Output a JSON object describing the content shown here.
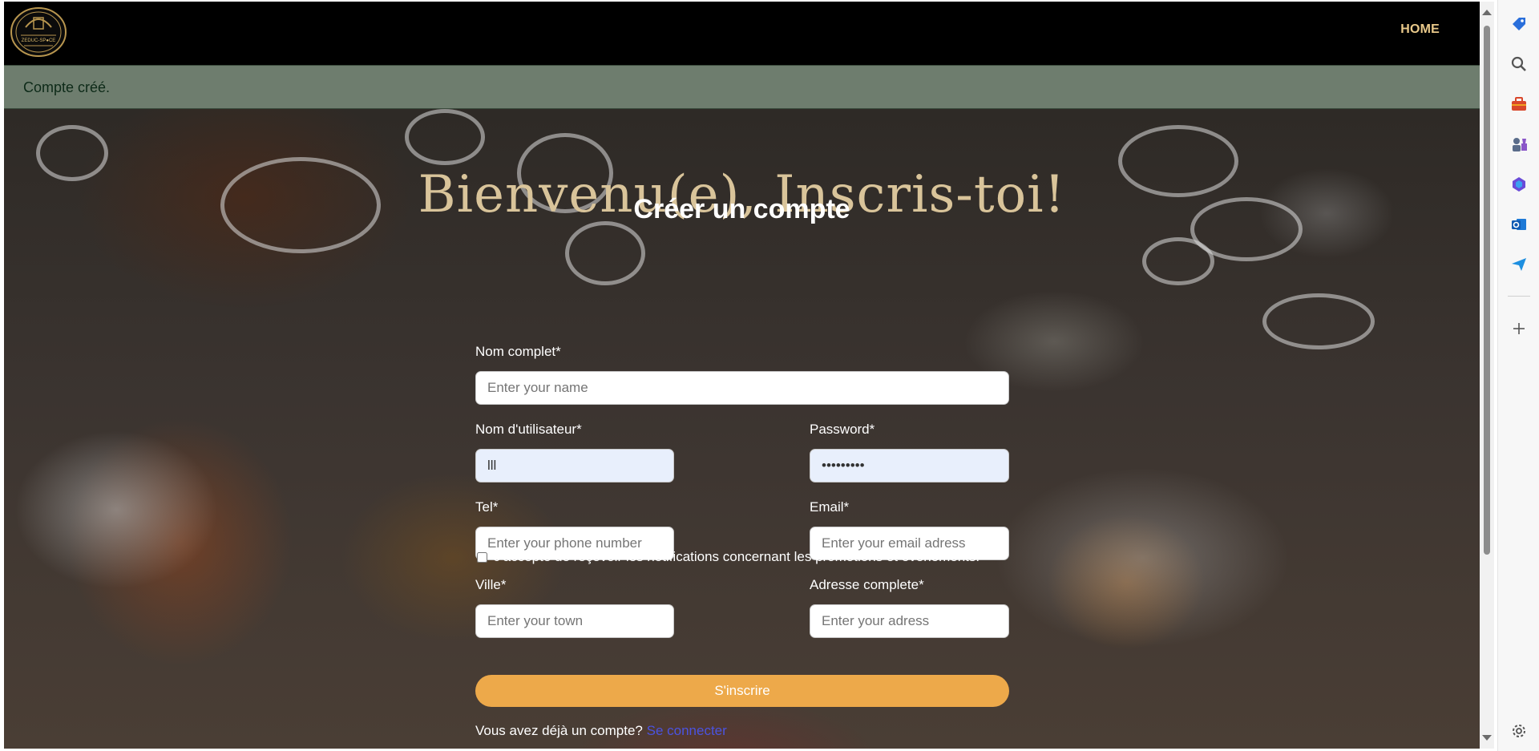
{
  "navbar": {
    "home_label": "HOME",
    "logo_text": "ZEDUC-SPACE"
  },
  "alert": {
    "message": "Compte créé."
  },
  "hero": {
    "title": "Bienvenu(e), Inscris-toi!"
  },
  "form": {
    "title": "Créer un compte",
    "fullname": {
      "label": "Nom complet*",
      "placeholder": "Enter your name",
      "value": ""
    },
    "username": {
      "label": "Nom d'utilisateur*",
      "placeholder": "",
      "value": "lll"
    },
    "password": {
      "label": "Password*",
      "value": "•••••••••"
    },
    "tel": {
      "label": "Tel*",
      "placeholder": "Enter your phone number",
      "value": ""
    },
    "email": {
      "label": "Email*",
      "placeholder": "Enter your email adress",
      "value": ""
    },
    "ville": {
      "label": "Ville*",
      "placeholder": "Enter your town",
      "value": ""
    },
    "adresse": {
      "label": "Adresse complete*",
      "placeholder": "Enter your adress",
      "value": ""
    },
    "consent_label": "J'accepte de reçevoir les notifications concernant les promotions et évènements.",
    "consent_checked": false,
    "submit_label": "S'inscrire",
    "login_prompt": "Vous avez déjà un compte?",
    "login_link": "Se connecter"
  },
  "colors": {
    "accent": "#eda94a",
    "title": "#d9c49a",
    "alert_bg": "#6e7d6e",
    "link": "#4b53e0"
  },
  "browser_sidebar": {
    "icons": [
      "tag-icon",
      "search-icon",
      "toolbox-icon",
      "chess-icon",
      "copilot-icon",
      "outlook-icon",
      "send-icon",
      "add-icon",
      "settings-icon"
    ]
  }
}
